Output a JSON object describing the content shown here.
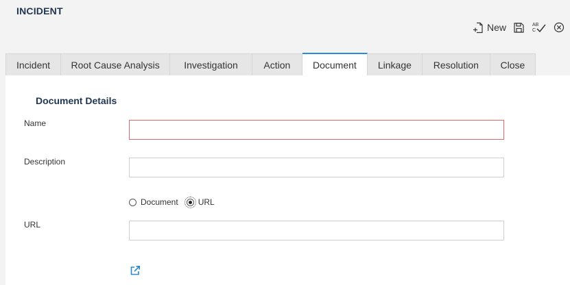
{
  "page": {
    "title": "INCIDENT"
  },
  "toolbar": {
    "new_label": "New",
    "icons": [
      "new-document-icon",
      "save-icon",
      "spellcheck-icon",
      "close-circle-icon"
    ]
  },
  "tabs": [
    {
      "label": "Incident",
      "active": false
    },
    {
      "label": "Root Cause Analysis",
      "active": false
    },
    {
      "label": "Investigation",
      "active": false
    },
    {
      "label": "Action",
      "active": false
    },
    {
      "label": "Document",
      "active": true
    },
    {
      "label": "Linkage",
      "active": false
    },
    {
      "label": "Resolution",
      "active": false
    },
    {
      "label": "Close",
      "active": false
    }
  ],
  "form": {
    "section_title": "Document Details",
    "name": {
      "label": "Name",
      "value": "",
      "invalid": true
    },
    "description": {
      "label": "Description",
      "value": ""
    },
    "type": {
      "options": [
        "Document",
        "URL"
      ],
      "selected": "URL"
    },
    "url": {
      "label": "URL",
      "value": ""
    },
    "link_icon": "external-link-icon"
  },
  "colors": {
    "accent": "#2a8bd0",
    "title": "#1f3550",
    "invalid_border": "#e0666b",
    "background": "#f3f3f3"
  }
}
